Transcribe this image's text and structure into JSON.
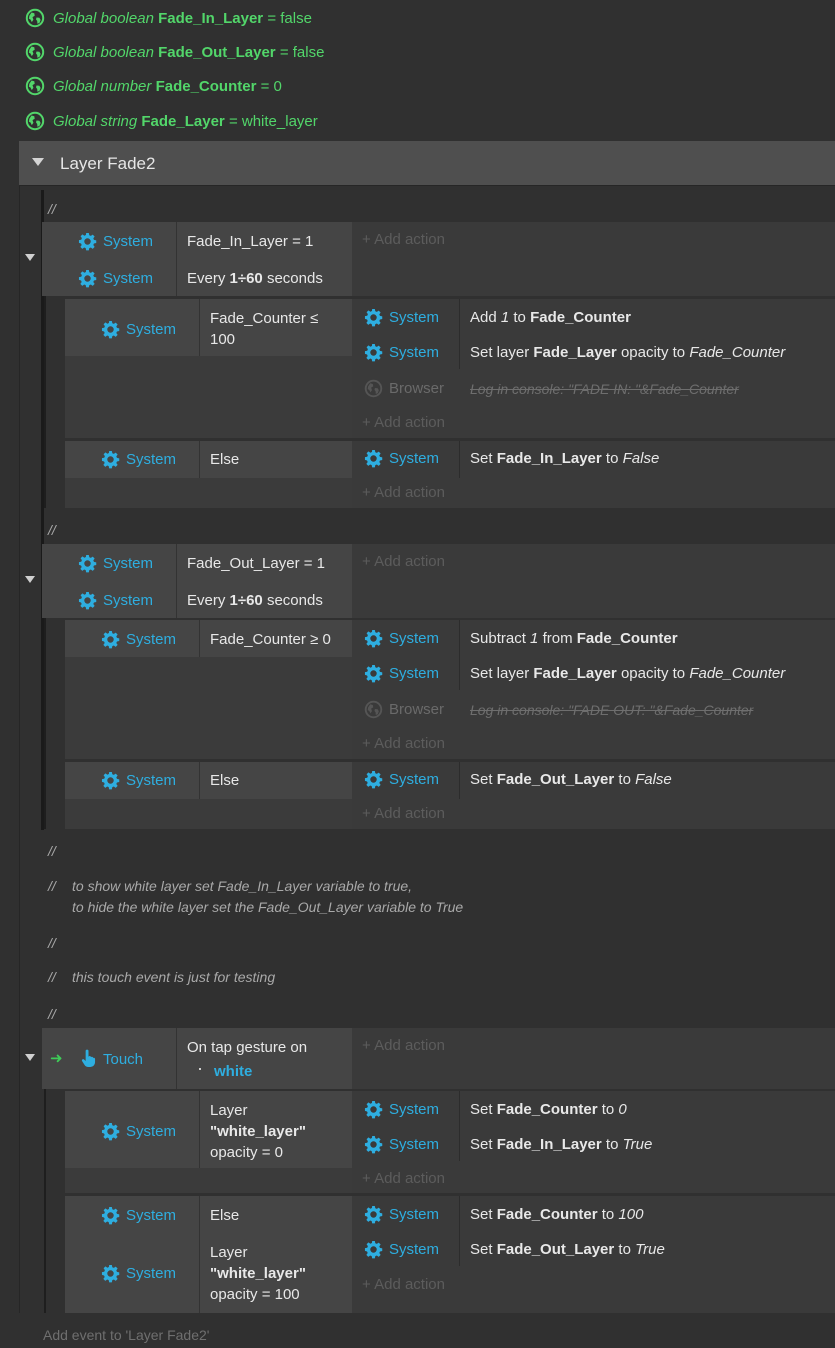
{
  "globals": [
    {
      "prefix": "Global boolean",
      "name": "Fade_In_Layer",
      "value": "= false"
    },
    {
      "prefix": "Global boolean",
      "name": "Fade_Out_Layer",
      "value": "= false"
    },
    {
      "prefix": "Global number",
      "name": "Fade_Counter",
      "value": "= 0"
    },
    {
      "prefix": "Global string",
      "name": "Fade_Layer",
      "value": "= white_layer"
    }
  ],
  "group": {
    "title": "Layer Fade2",
    "add_event": "Add event to 'Layer Fade2'"
  },
  "labels": {
    "system": "System",
    "browser": "Browser",
    "touch": "Touch",
    "add_action": "Add action",
    "comment_mark": "//"
  },
  "comments": {
    "c4_line1": "to show white layer set Fade_In_Layer variable to true,",
    "c4_line2": "to hide the white layer set the Fade_Out_Layer variable to True",
    "c6": "this touch event is just for testing"
  },
  "event1": {
    "cond1": "Fade_In_Layer = 1",
    "cond2_pre": "Every",
    "cond2_num": "1÷60",
    "cond2_post": "seconds",
    "sub1": {
      "cond_l1": "Fade_Counter ≤",
      "cond_l2": "100",
      "a1": {
        "pre": "Add",
        "num": "1",
        "mid": "to",
        "name": "Fade_Counter"
      },
      "a2": {
        "pre": "Set layer",
        "name": "Fade_Layer",
        "mid": "opacity to",
        "val": "Fade_Counter"
      },
      "a3": "Log in console: \"FADE IN: \"&Fade_Counter"
    },
    "sub2": {
      "cond": "Else",
      "a1": {
        "pre": "Set",
        "name": "Fade_In_Layer",
        "mid": "to",
        "val": "False"
      }
    }
  },
  "event2": {
    "cond1": "Fade_Out_Layer = 1",
    "cond2_pre": "Every",
    "cond2_num": "1÷60",
    "cond2_post": "seconds",
    "sub1": {
      "cond": "Fade_Counter ≥ 0",
      "a1": {
        "pre": "Subtract",
        "num": "1",
        "mid": "from",
        "name": "Fade_Counter"
      },
      "a2": {
        "pre": "Set layer",
        "name": "Fade_Layer",
        "mid": "opacity to",
        "val": "Fade_Counter"
      },
      "a3": "Log in console: \"FADE OUT: \"&Fade_Counter"
    },
    "sub2": {
      "cond": "Else",
      "a1": {
        "pre": "Set",
        "name": "Fade_Out_Layer",
        "mid": "to",
        "val": "False"
      }
    }
  },
  "event3": {
    "cond_l1": "On tap gesture on",
    "cond_obj": "white",
    "sub1": {
      "cond_l1": "Layer",
      "cond_l2": "\"white_layer\"",
      "cond_l3": "opacity = 0",
      "a1": {
        "pre": "Set",
        "name": "Fade_Counter",
        "mid": "to",
        "val": "0"
      },
      "a2": {
        "pre": "Set",
        "name": "Fade_In_Layer",
        "mid": "to",
        "val": "True"
      }
    },
    "sub2": {
      "cond1": "Else",
      "cond2_l1": "Layer",
      "cond2_l2": "\"white_layer\"",
      "cond2_l3": "opacity = 100",
      "a1": {
        "pre": "Set",
        "name": "Fade_Counter",
        "mid": "to",
        "val": "100"
      },
      "a2": {
        "pre": "Set",
        "name": "Fade_Out_Layer",
        "mid": "to",
        "val": "True"
      }
    }
  },
  "colors": {
    "system_blue": "#2eaee0",
    "global_green": "#52d66a",
    "background": "#303030"
  }
}
